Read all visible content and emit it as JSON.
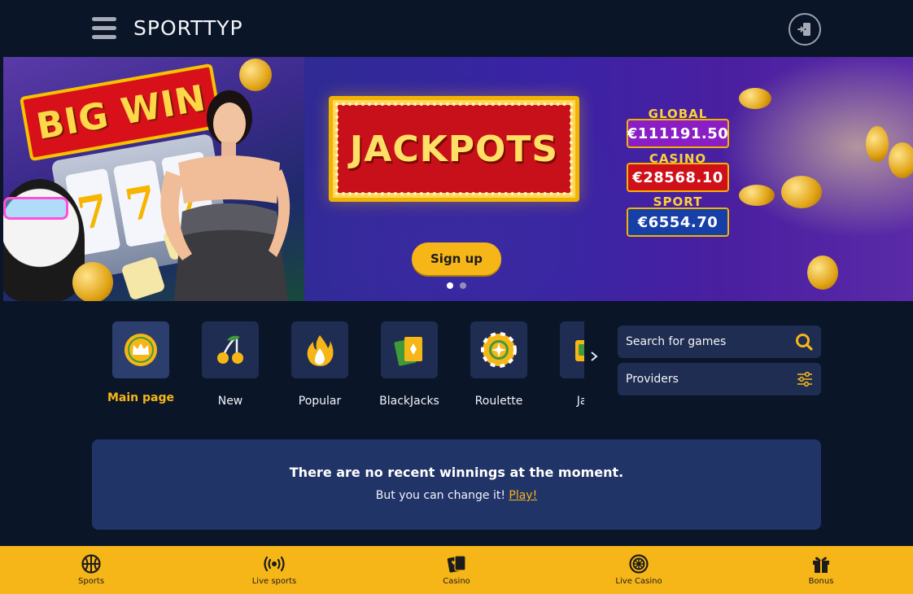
{
  "header": {
    "logo": "SPORTTYP",
    "menu_icon": "hamburger-menu-icon",
    "login_icon": "login-door-icon"
  },
  "banner": {
    "big_win_text": "BIG WIN",
    "slot_reels": [
      "7",
      "7",
      "7"
    ],
    "jackpot_title": "JACKPOTS",
    "jackpots": [
      {
        "label": "GLOBAL",
        "value": "€111191.50",
        "color": "#8a1ec4"
      },
      {
        "label": "CASINO",
        "value": "€28568.10",
        "color": "#d01018"
      },
      {
        "label": "SPORT",
        "value": "€6554.70",
        "color": "#1640a8"
      }
    ],
    "signup_label": "Sign up",
    "slides": {
      "current": 1,
      "total": 2
    }
  },
  "categories": [
    {
      "label": "Main page",
      "icon": "crown-icon",
      "active": true
    },
    {
      "label": "New",
      "icon": "cherries-icon",
      "active": false
    },
    {
      "label": "Popular",
      "icon": "fire-icon",
      "active": false
    },
    {
      "label": "BlackJacks",
      "icon": "playing-cards-icon",
      "active": false
    },
    {
      "label": "Roulette",
      "icon": "roulette-chip-icon",
      "active": false
    },
    {
      "label": "Jack",
      "icon": "jackpot-icon",
      "active": false
    }
  ],
  "search": {
    "placeholder": "Search for games"
  },
  "providers": {
    "label": "Providers"
  },
  "winnings": {
    "title": "There are no recent winnings at the moment.",
    "subtitle": "But you can change it!",
    "link": "Play!"
  },
  "bottom_nav": [
    {
      "label": "Sports",
      "icon": "basketball-icon"
    },
    {
      "label": "Live sports",
      "icon": "broadcast-icon"
    },
    {
      "label": "Casino",
      "icon": "cards-icon"
    },
    {
      "label": "Live Casino",
      "icon": "roulette-wheel-icon"
    },
    {
      "label": "Bonus",
      "icon": "gift-icon"
    }
  ],
  "colors": {
    "accent": "#f6b617",
    "background": "#0b1528",
    "tile": "#1f2d52",
    "panel": "#213468"
  }
}
